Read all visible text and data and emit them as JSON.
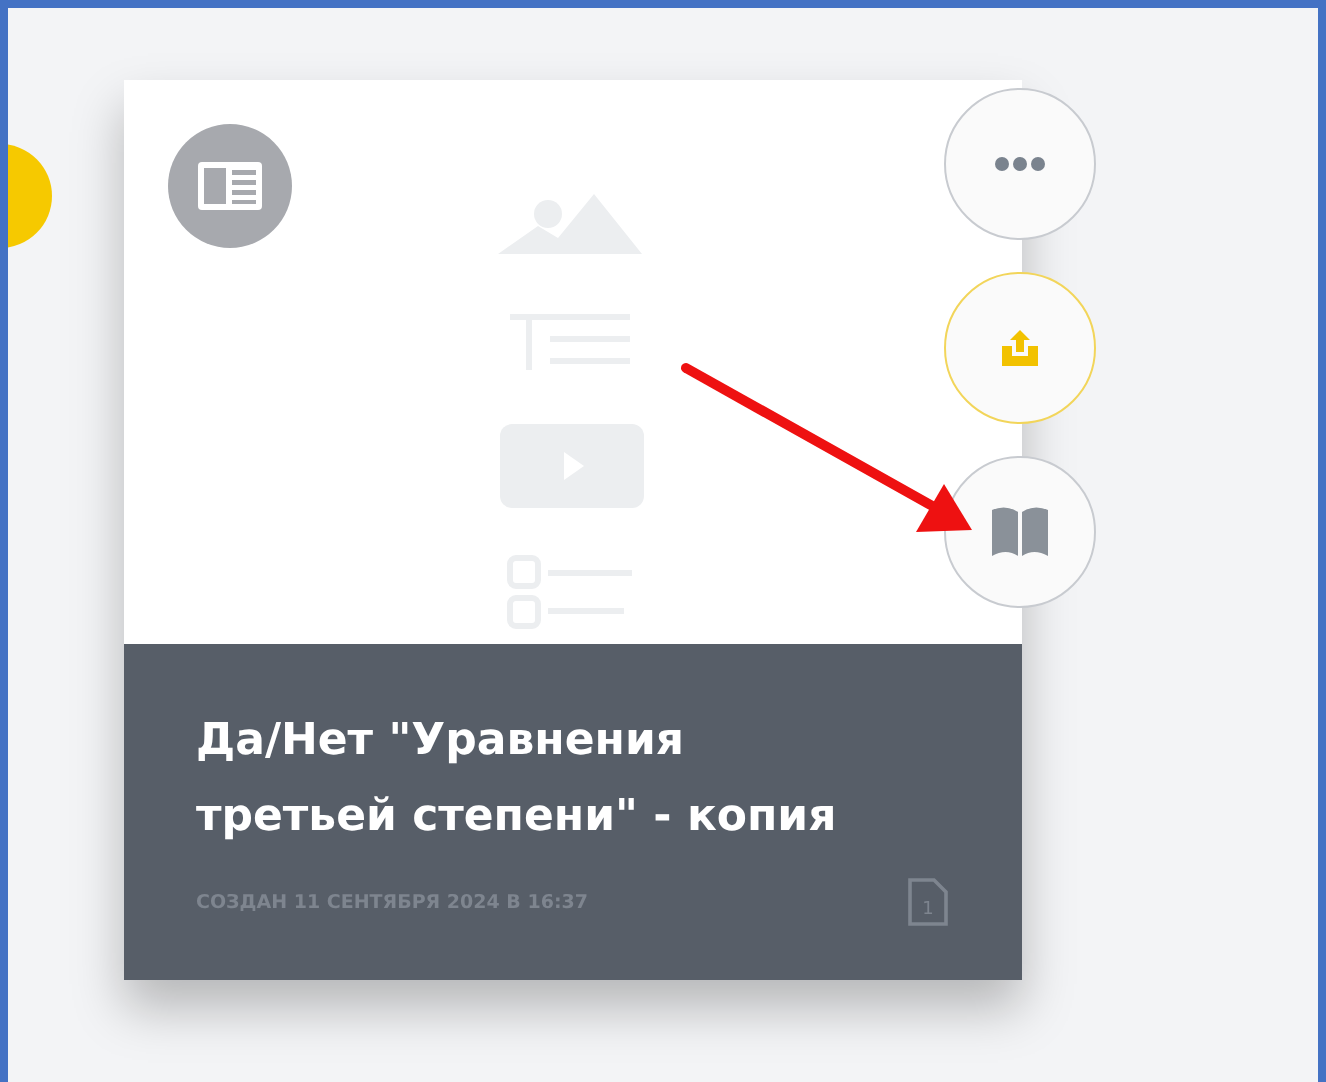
{
  "card": {
    "title": "Да/Нет \"Уравнения третьей степени\" - копия",
    "created": "СОЗДАН 11 СЕНТЯБРЯ 2024 В 16:37",
    "page_count": "1"
  }
}
